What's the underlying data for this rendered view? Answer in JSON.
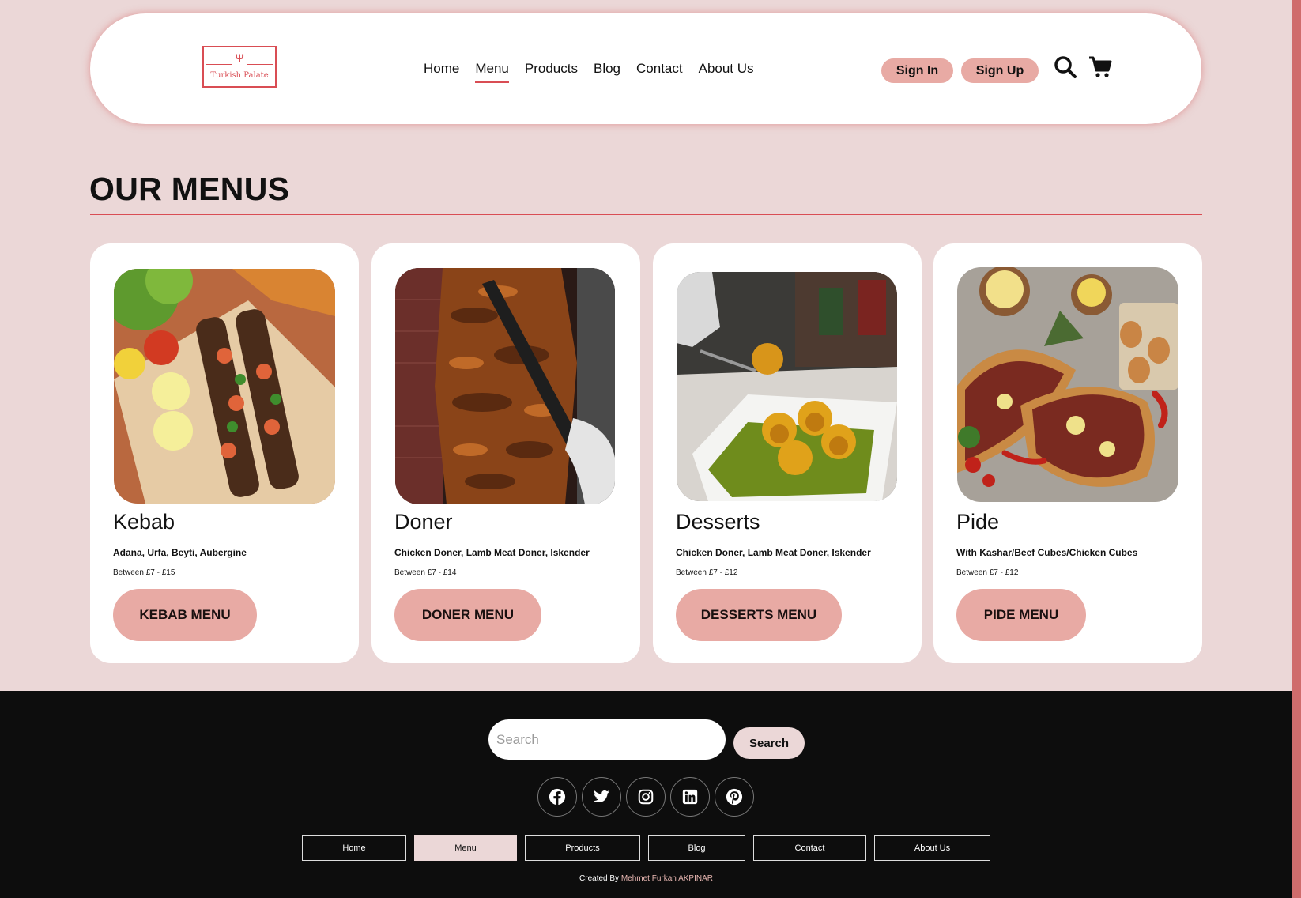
{
  "brand": {
    "logo_text": "Turkish Palate",
    "logo_glyph": "Ψ",
    "accent_color": "#d94d54",
    "button_color": "#e8aaa4",
    "page_bg": "#ebd7d7"
  },
  "header": {
    "nav": [
      "Home",
      "Menu",
      "Products",
      "Blog",
      "Contact",
      "About Us"
    ],
    "active_nav": "Menu",
    "sign_in": "Sign In",
    "sign_up": "Sign Up",
    "icons": [
      "search-icon",
      "cart-icon"
    ]
  },
  "main": {
    "title": "OUR MENUS",
    "cards": [
      {
        "name": "Kebab",
        "desc": "Adana, Urfa, Beyti, Aubergine",
        "price": "Between £7 - £15",
        "button": "KEBAB MENU",
        "image": "kebab skewers on cutting board"
      },
      {
        "name": "Doner",
        "desc": "Chicken Doner, Lamb Meat Doner, Iskender",
        "price": "Between £7 - £14",
        "button": "DONER MENU",
        "image": "doner meat being sliced"
      },
      {
        "name": "Desserts",
        "desc": "Chicken Doner, Lamb Meat Doner, Iskender",
        "price": "Between £7 - £12",
        "button": "DESSERTS MENU",
        "image": "baklava with pistachio"
      },
      {
        "name": "Pide",
        "desc": "With Kashar/Beef Cubes/Chicken Cubes",
        "price": "Between £7 - £12",
        "button": "PIDE MENU",
        "image": "turkish pide with toppings"
      }
    ]
  },
  "footer": {
    "search_placeholder": "Search",
    "search_button": "Search",
    "socials": [
      "facebook-icon",
      "twitter-icon",
      "instagram-icon",
      "linkedin-icon",
      "pinterest-icon"
    ],
    "nav": [
      "Home",
      "Menu",
      "Products",
      "Blog",
      "Contact",
      "About Us"
    ],
    "active_nav": "Menu",
    "credit_prefix": "Created By",
    "credit_author": "Mehmet Furkan AKPINAR"
  }
}
